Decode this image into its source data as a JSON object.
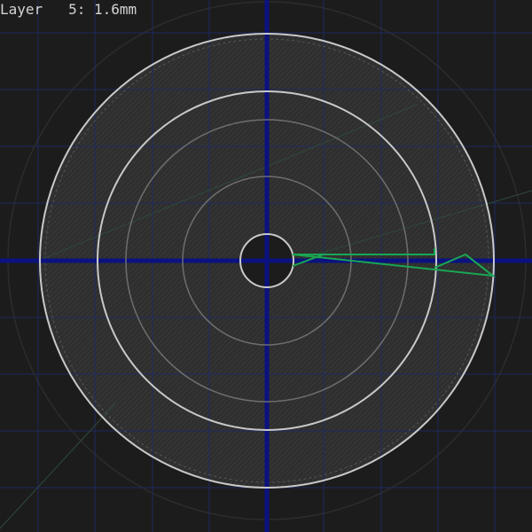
{
  "status": {
    "layer_label": "Layer",
    "layer_number": "5",
    "layer_height": "1.6mm"
  },
  "colors": {
    "background": "#1c1c1c",
    "grid": "#1f2a66",
    "axis": "#0b1280",
    "outline": "#c9c9c9",
    "fill_hatch": "#3a3a3a",
    "toolpath": "#1aa653",
    "travel": "#2f4a3a"
  }
}
